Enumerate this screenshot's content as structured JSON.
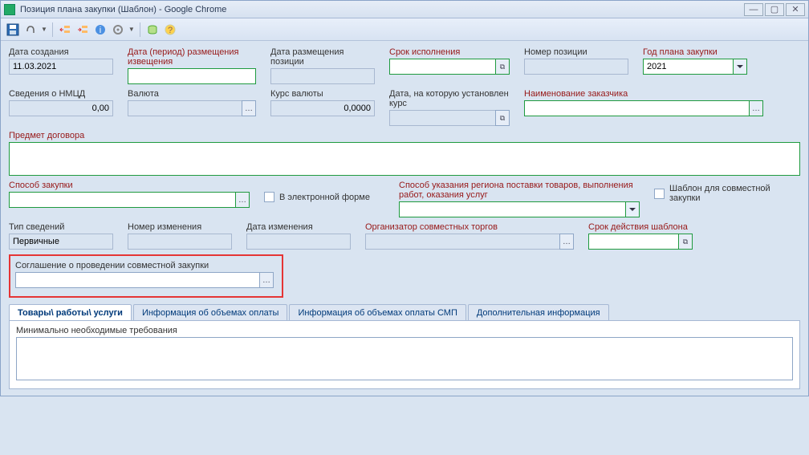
{
  "window": {
    "title": "Позиция плана закупки (Шаблон) - Google Chrome"
  },
  "toolbar_icons": [
    "save",
    "attach",
    "",
    "left",
    "right",
    "info",
    "gear",
    "",
    "db",
    "help"
  ],
  "f": {
    "created_label": "Дата создания",
    "created_value": "11.03.2021",
    "period_label": "Дата (период) размещения извещения",
    "placed_label": "Дата размещения позиции",
    "deadline_label": "Срок исполнения",
    "posnum_label": "Номер позиции",
    "planyear_label": "Год плана закупки",
    "planyear_value": "2021",
    "nmcd_label": "Сведения о НМЦД",
    "nmcd_value": "0,00",
    "currency_label": "Валюта",
    "rate_label": "Курс валюты",
    "rate_value": "0,0000",
    "ratedate_label": "Дата, на которую установлен курс",
    "customer_label": "Наименование заказчика",
    "subject_label": "Предмет договора",
    "method_label": "Способ закупки",
    "eform_label": "В электронной форме",
    "region_label": "Способ указания региона поставки товаров, выполнения работ, оказания услуг",
    "joint_tpl_label": "Шаблон для совместной закупки",
    "infotype_label": "Тип сведений",
    "infotype_value": "Первичные",
    "changenum_label": "Номер изменения",
    "changedate_label": "Дата изменения",
    "organizer_label": "Организатор совместных торгов",
    "validity_label": "Срок действия шаблона",
    "agreement_label": "Соглашение о проведении совместной закупки"
  },
  "tabs": {
    "t1": "Товары\\ работы\\ услуги",
    "t2": "Информация об объемах оплаты",
    "t3": "Информация об объемах оплаты СМП",
    "t4": "Дополнительная информация"
  },
  "tabbody": {
    "minreq_label": "Минимально необходимые требования"
  }
}
